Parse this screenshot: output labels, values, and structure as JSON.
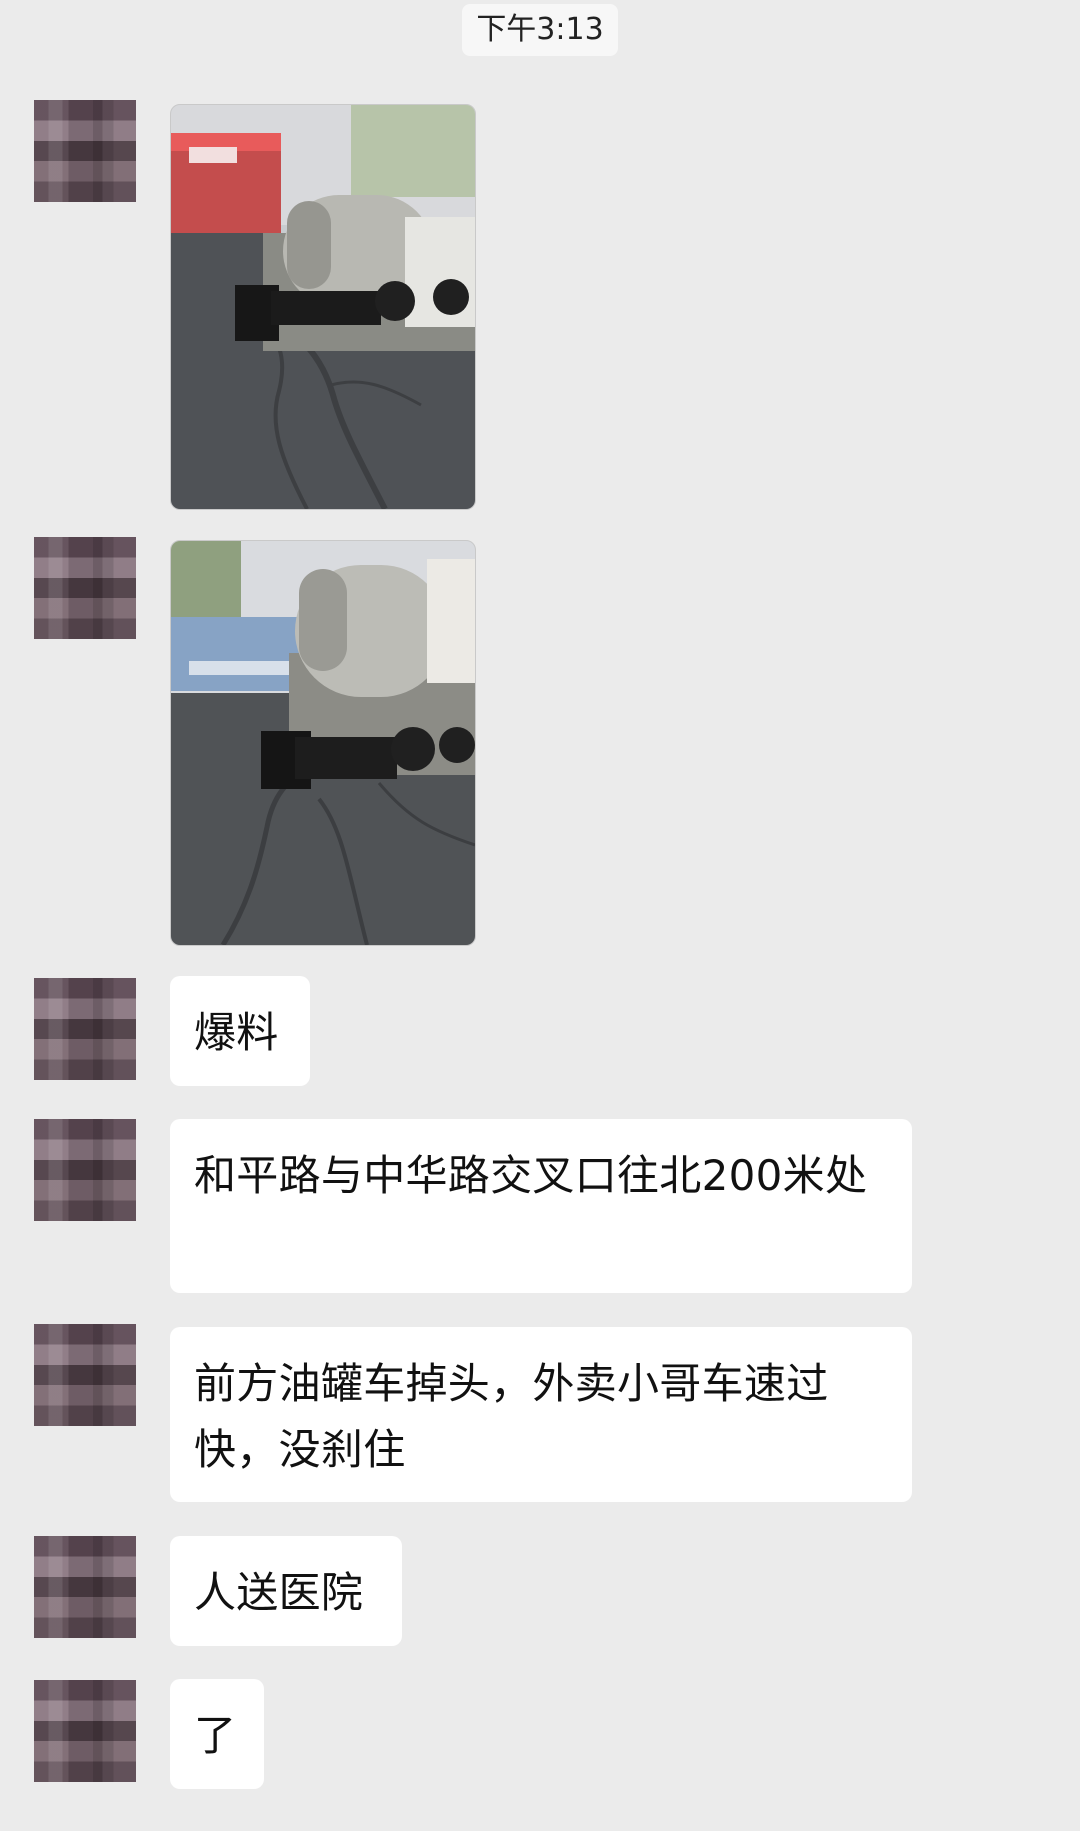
{
  "chat": {
    "timestamp": "下午3:13",
    "messages": [
      {
        "type": "image",
        "avatar_icon": "blurred-avatar-icon"
      },
      {
        "type": "image",
        "avatar_icon": "blurred-avatar-icon"
      },
      {
        "type": "text",
        "text": "爆料"
      },
      {
        "type": "text",
        "text": "和平路与中华路交叉口往北200米处"
      },
      {
        "type": "text",
        "text": "前方油罐车掉头，外卖小哥车速过快，没刹住"
      },
      {
        "type": "text",
        "text": "人送医院"
      },
      {
        "type": "text",
        "text": "了"
      }
    ]
  }
}
